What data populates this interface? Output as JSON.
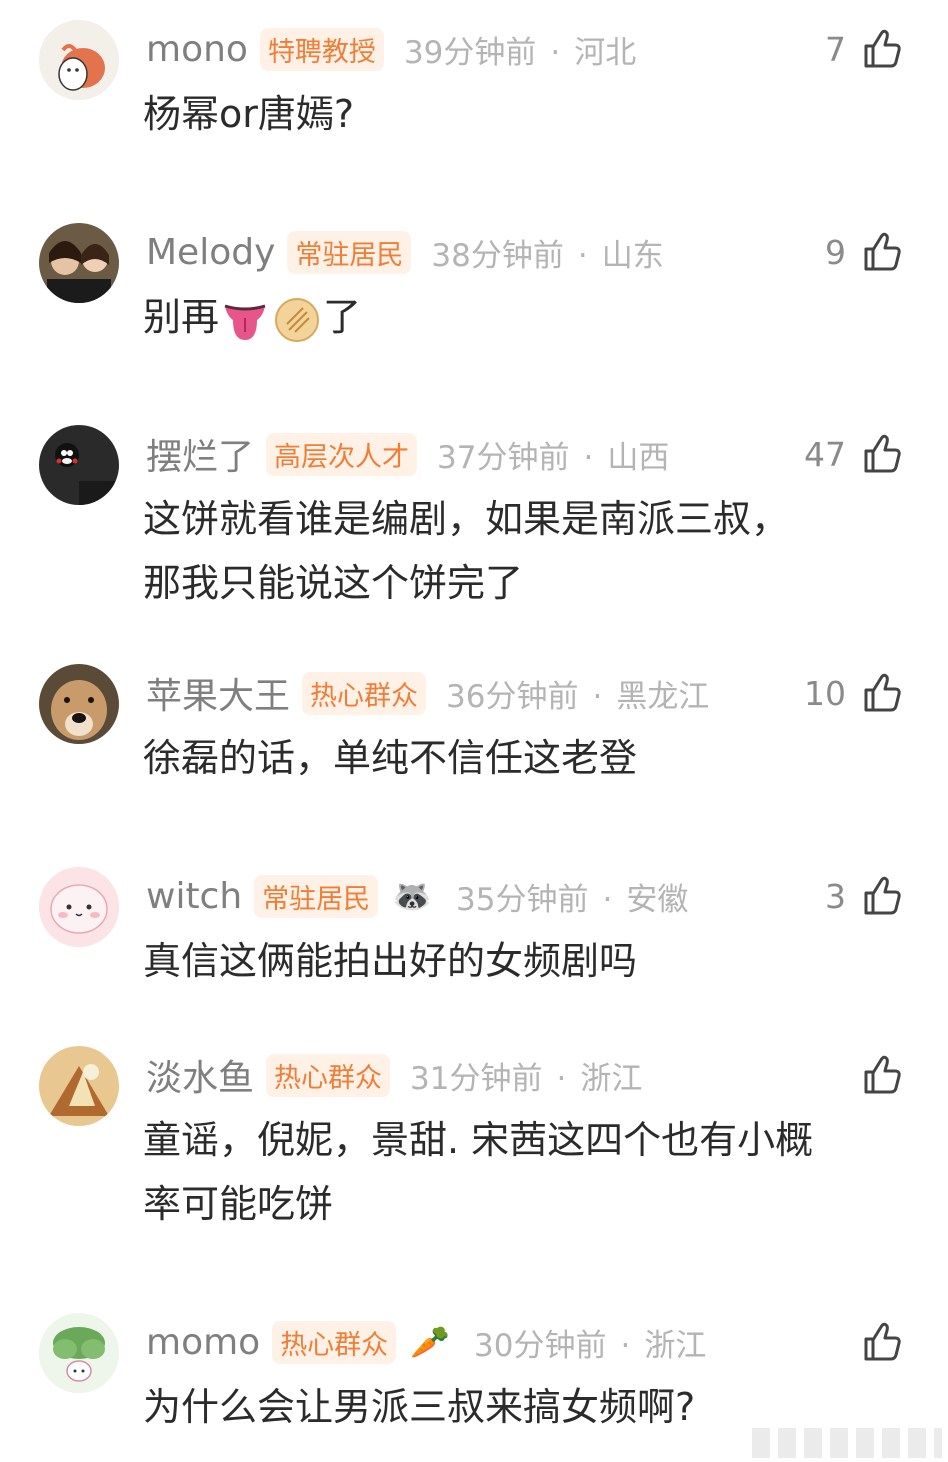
{
  "comments": [
    {
      "username": "mono",
      "badge": "特聘教授",
      "time": "39分钟前",
      "location": "河北",
      "likes": "7",
      "lines": [
        "杨幂or唐嫣?"
      ],
      "avatar_color": "#f3efe9"
    },
    {
      "username": "Melody",
      "badge": "常驻居民",
      "time": "38分钟前",
      "location": "山东",
      "likes": "9",
      "text_prefix": "别再",
      "text_suffix": "了",
      "avatar_color": "#6b5a44"
    },
    {
      "username": "摆烂了",
      "badge": "高层次人才",
      "time": "37分钟前",
      "location": "山西",
      "likes": "47",
      "lines": [
        "这饼就看谁是编剧，如果是南派三叔，",
        "那我只能说这个饼完了"
      ],
      "avatar_color": "#2a2a2a"
    },
    {
      "username": "苹果大王",
      "badge": "热心群众",
      "time": "36分钟前",
      "location": "黑龙江",
      "likes": "10",
      "lines": [
        "徐磊的话，单纯不信任这老登"
      ],
      "avatar_color": "#8a6a4a"
    },
    {
      "username": "witch",
      "badge": "常驻居民",
      "extra_icon": "🦝",
      "time": "35分钟前",
      "location": "安徽",
      "likes": "3",
      "lines": [
        "真信这俩能拍出好的女频剧吗"
      ],
      "avatar_color": "#fbe3e6"
    },
    {
      "username": "淡水鱼",
      "badge": "热心群众",
      "time": "31分钟前",
      "location": "浙江",
      "likes": "",
      "lines": [
        "童谣，倪妮，景甜. 宋茜这四个也有小概",
        "率可能吃饼"
      ],
      "avatar_color": "#c8a060"
    },
    {
      "username": "momo",
      "badge": "热心群众",
      "extra_icon": "🥕",
      "time": "30分钟前",
      "location": "浙江",
      "likes": "",
      "lines": [
        "为什么会让男派三叔来搞女频啊?"
      ],
      "avatar_color": "#eef5ea"
    }
  ],
  "separator": "·"
}
